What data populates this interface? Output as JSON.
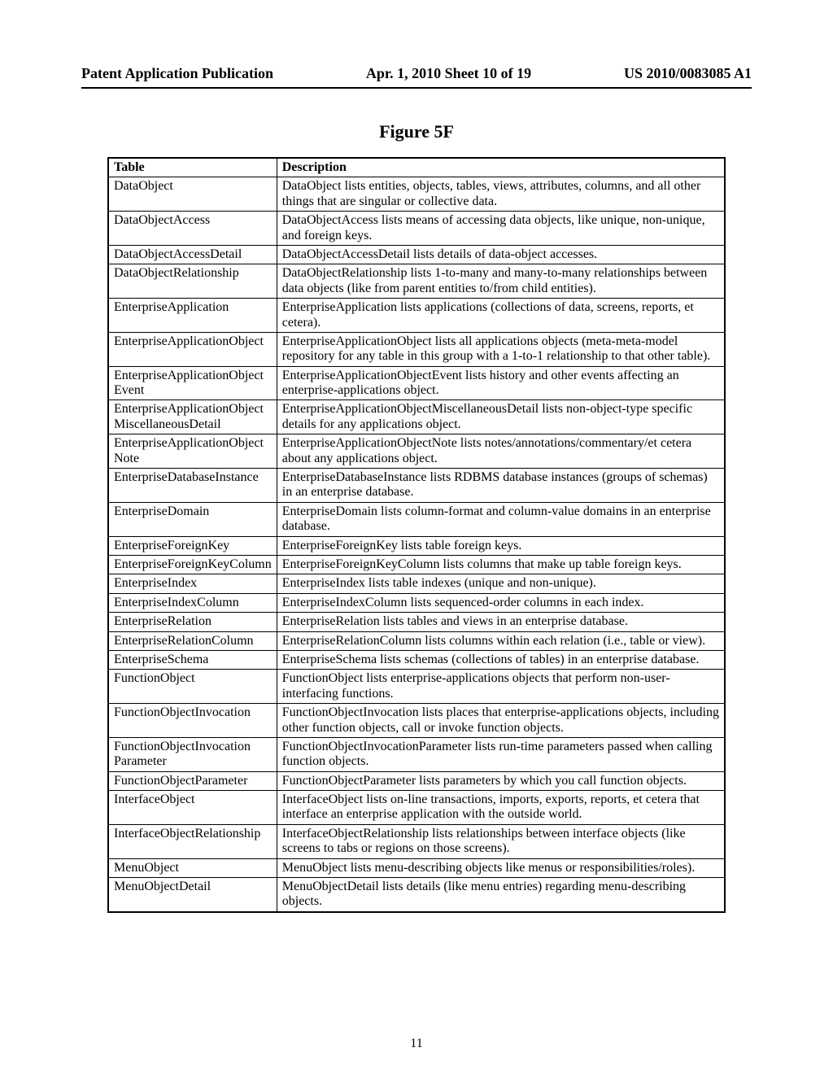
{
  "header": {
    "left": "Patent Application Publication",
    "center": "Apr. 1, 2010  Sheet 10 of 19",
    "right": "US 2010/0083085 A1"
  },
  "figure_title": "Figure 5F",
  "table": {
    "headers": {
      "col1": "Table",
      "col2": "Description"
    },
    "rows": [
      {
        "name": "DataObject",
        "desc": "DataObject lists entities, objects, tables, views, attributes, columns, and all other things that are singular or collective data."
      },
      {
        "name": "DataObjectAccess",
        "desc": "DataObjectAccess lists means of accessing data objects, like unique, non-unique, and foreign keys."
      },
      {
        "name": "DataObjectAccessDetail",
        "desc": "DataObjectAccessDetail lists details of data-object accesses."
      },
      {
        "name": "DataObjectRelationship",
        "desc": "DataObjectRelationship lists 1-to-many and many-to-many relationships between data objects (like from parent entities to/from child entities)."
      },
      {
        "name": "EnterpriseApplication",
        "desc": "EnterpriseApplication lists applications (collections of data, screens, reports, et cetera)."
      },
      {
        "name": "EnterpriseApplicationObject",
        "desc": "EnterpriseApplicationObject lists all applications objects (meta-meta-model repository for any table in this group with a 1-to-1 relationship to that other table)."
      },
      {
        "name": "EnterpriseApplicationObject Event",
        "desc": "EnterpriseApplicationObjectEvent lists history and other events affecting an enterprise-applications object."
      },
      {
        "name": "EnterpriseApplicationObject MiscellaneousDetail",
        "desc": "EnterpriseApplicationObjectMiscellaneousDetail lists non-object-type specific details for any applications object."
      },
      {
        "name": "EnterpriseApplicationObject Note",
        "desc": "EnterpriseApplicationObjectNote lists notes/annotations/commentary/et cetera about any applications object."
      },
      {
        "name": "EnterpriseDatabaseInstance",
        "desc": "EnterpriseDatabaseInstance lists RDBMS database instances (groups of schemas) in an enterprise database."
      },
      {
        "name": "EnterpriseDomain",
        "desc": "EnterpriseDomain lists column-format and column-value domains in an enterprise database."
      },
      {
        "name": "EnterpriseForeignKey",
        "desc": "EnterpriseForeignKey lists table foreign keys."
      },
      {
        "name": "EnterpriseForeignKeyColumn",
        "desc": "EnterpriseForeignKeyColumn lists columns that make up table foreign keys."
      },
      {
        "name": "EnterpriseIndex",
        "desc": "EnterpriseIndex lists table indexes (unique and non-unique)."
      },
      {
        "name": "EnterpriseIndexColumn",
        "desc": "EnterpriseIndexColumn lists sequenced-order columns in each index."
      },
      {
        "name": "EnterpriseRelation",
        "desc": "EnterpriseRelation lists tables and views in an enterprise database."
      },
      {
        "name": "EnterpriseRelationColumn",
        "desc": "EnterpriseRelationColumn lists columns within each relation (i.e., table or view)."
      },
      {
        "name": "EnterpriseSchema",
        "desc": "EnterpriseSchema lists schemas (collections of tables) in an enterprise database."
      },
      {
        "name": "FunctionObject",
        "desc": "FunctionObject lists enterprise-applications objects that perform non-user-interfacing functions."
      },
      {
        "name": "FunctionObjectInvocation",
        "desc": "FunctionObjectInvocation lists places that enterprise-applications objects, including other function objects, call or invoke function objects."
      },
      {
        "name": "FunctionObjectInvocation Parameter",
        "desc": "FunctionObjectInvocationParameter lists run-time parameters passed when calling function objects."
      },
      {
        "name": "FunctionObjectParameter",
        "desc": "FunctionObjectParameter lists parameters by which you call function objects."
      },
      {
        "name": "InterfaceObject",
        "desc": "InterfaceObject lists on-line transactions, imports, exports, reports, et cetera that interface an enterprise application with the outside world."
      },
      {
        "name": "InterfaceObjectRelationship",
        "desc": "InterfaceObjectRelationship lists relationships between interface objects (like screens to tabs or regions on those screens)."
      },
      {
        "name": "MenuObject",
        "desc": "MenuObject lists menu-describing objects like menus or responsibilities/roles)."
      },
      {
        "name": "MenuObjectDetail",
        "desc": "MenuObjectDetail lists details (like menu entries) regarding menu-describing objects."
      }
    ]
  },
  "page_number": "11"
}
